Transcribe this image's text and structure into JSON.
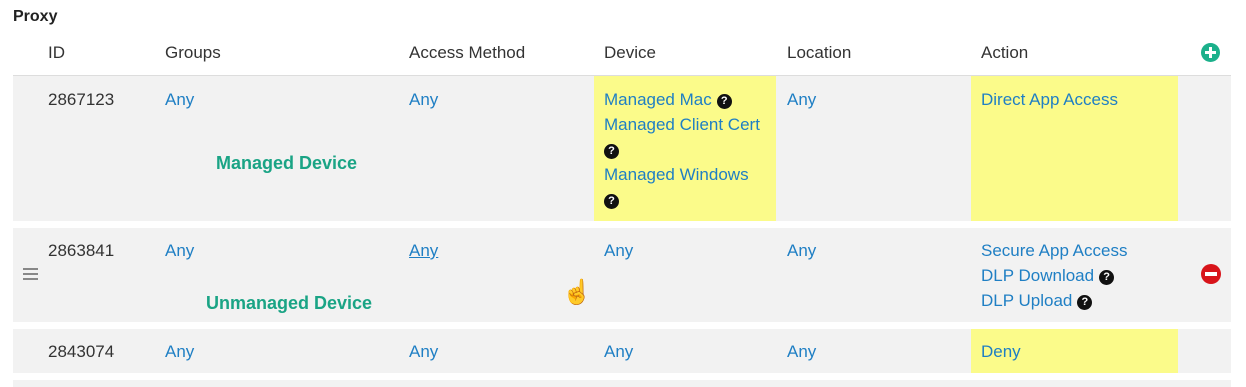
{
  "section_title": "Proxy",
  "headers": {
    "id": "ID",
    "groups": "Groups",
    "access_method": "Access Method",
    "device": "Device",
    "location": "Location",
    "action": "Action"
  },
  "rows": [
    {
      "id": "2867123",
      "groups": "Any",
      "access_method": "Any",
      "devices": [
        "Managed Mac",
        "Managed Client Cert",
        "Managed Windows"
      ],
      "location": "Any",
      "actions": [
        "Direct App Access"
      ],
      "label": "Managed Device"
    },
    {
      "id": "2863841",
      "groups": "Any",
      "access_method": "Any",
      "device": "Any",
      "location": "Any",
      "actions": [
        "Secure App Access",
        "DLP Download",
        "DLP Upload"
      ],
      "label": "Unmanaged Device"
    },
    {
      "id": "2843074",
      "groups": "Any",
      "access_method": "Any",
      "device": "Any",
      "location": "Any",
      "actions": [
        "Deny"
      ]
    }
  ],
  "icons": {
    "help": "question-circle-icon",
    "add": "plus-circle-icon",
    "remove": "minus-circle-icon",
    "drag": "drag-handle-icon",
    "cursor": "hand-pointer-icon"
  },
  "colors": {
    "highlight": "#fbfb8a",
    "link": "#1f7fc4",
    "label": "#1aa485",
    "add": "#1bb08b",
    "remove": "#d8141a"
  }
}
